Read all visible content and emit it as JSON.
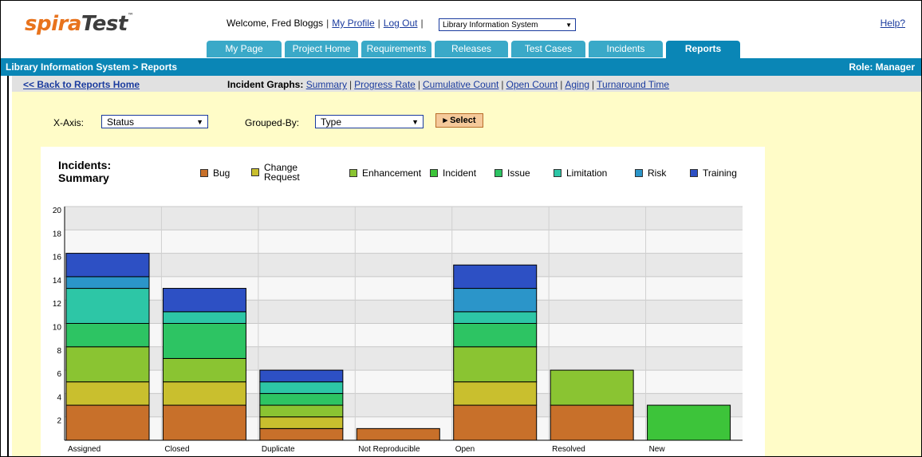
{
  "header": {
    "logo": {
      "spira": "spira",
      "test": "Test",
      "tm": "™"
    },
    "welcome_text": "Welcome, Fred Bloggs",
    "my_profile": "My Profile",
    "log_out": "Log Out",
    "project_select": "Library Information System",
    "help": "Help?"
  },
  "tabs": [
    {
      "label": "My Page",
      "active": false
    },
    {
      "label": "Project Home",
      "active": false
    },
    {
      "label": "Requirements",
      "active": false
    },
    {
      "label": "Releases",
      "active": false
    },
    {
      "label": "Test Cases",
      "active": false
    },
    {
      "label": "Incidents",
      "active": false
    },
    {
      "label": "Reports",
      "active": true
    }
  ],
  "breadcrumb": "Library Information System > Reports",
  "role": "Role: Manager",
  "back_link": "<< Back to Reports Home",
  "graph_nav": {
    "label": "Incident Graphs:",
    "links": [
      "Summary",
      "Progress Rate",
      "Cumulative Count",
      "Open Count",
      "Aging",
      "Turnaround Time"
    ]
  },
  "controls": {
    "x_axis_label": "X-Axis:",
    "x_axis_value": "Status",
    "grouped_by_label": "Grouped-By:",
    "grouped_by_value": "Type",
    "select_button": "▸ Select"
  },
  "chart_data": {
    "type": "bar",
    "stacked": true,
    "title_line1": "Incidents:",
    "title_line2": "Summary",
    "categories": [
      "Assigned",
      "Closed",
      "Duplicate",
      "Not Reproducible",
      "Open",
      "Resolved",
      "New"
    ],
    "series": [
      {
        "name": "Bug",
        "color": "#c8702a",
        "values": [
          3,
          3,
          1,
          1,
          3,
          3,
          0
        ]
      },
      {
        "name": "Change Request",
        "color": "#c9bf2e",
        "values": [
          2,
          2,
          1,
          0,
          2,
          0,
          0
        ]
      },
      {
        "name": "Enhancement",
        "color": "#8ac432",
        "values": [
          3,
          2,
          1,
          0,
          3,
          3,
          0
        ]
      },
      {
        "name": "Incident",
        "color": "#3dc43a",
        "values": [
          0,
          0,
          0,
          0,
          0,
          0,
          3
        ]
      },
      {
        "name": "Issue",
        "color": "#2dc463",
        "values": [
          2,
          3,
          1,
          0,
          2,
          0,
          0
        ]
      },
      {
        "name": "Limitation",
        "color": "#2dc6a6",
        "values": [
          3,
          1,
          1,
          0,
          1,
          0,
          0
        ]
      },
      {
        "name": "Risk",
        "color": "#2b95c9",
        "values": [
          1,
          0,
          0,
          0,
          2,
          0,
          0
        ]
      },
      {
        "name": "Training",
        "color": "#2d50c4",
        "values": [
          2,
          2,
          1,
          0,
          2,
          0,
          0
        ]
      }
    ],
    "legend": [
      "Bug",
      "Change Request",
      "Enhancement",
      "Incident",
      "Issue",
      "Limitation",
      "Risk",
      "Training"
    ],
    "yticks": [
      "20",
      "18",
      "16",
      "14",
      "12",
      "10",
      "8",
      "6",
      "4",
      "2"
    ],
    "ylim": [
      0,
      20
    ],
    "grid": true
  }
}
